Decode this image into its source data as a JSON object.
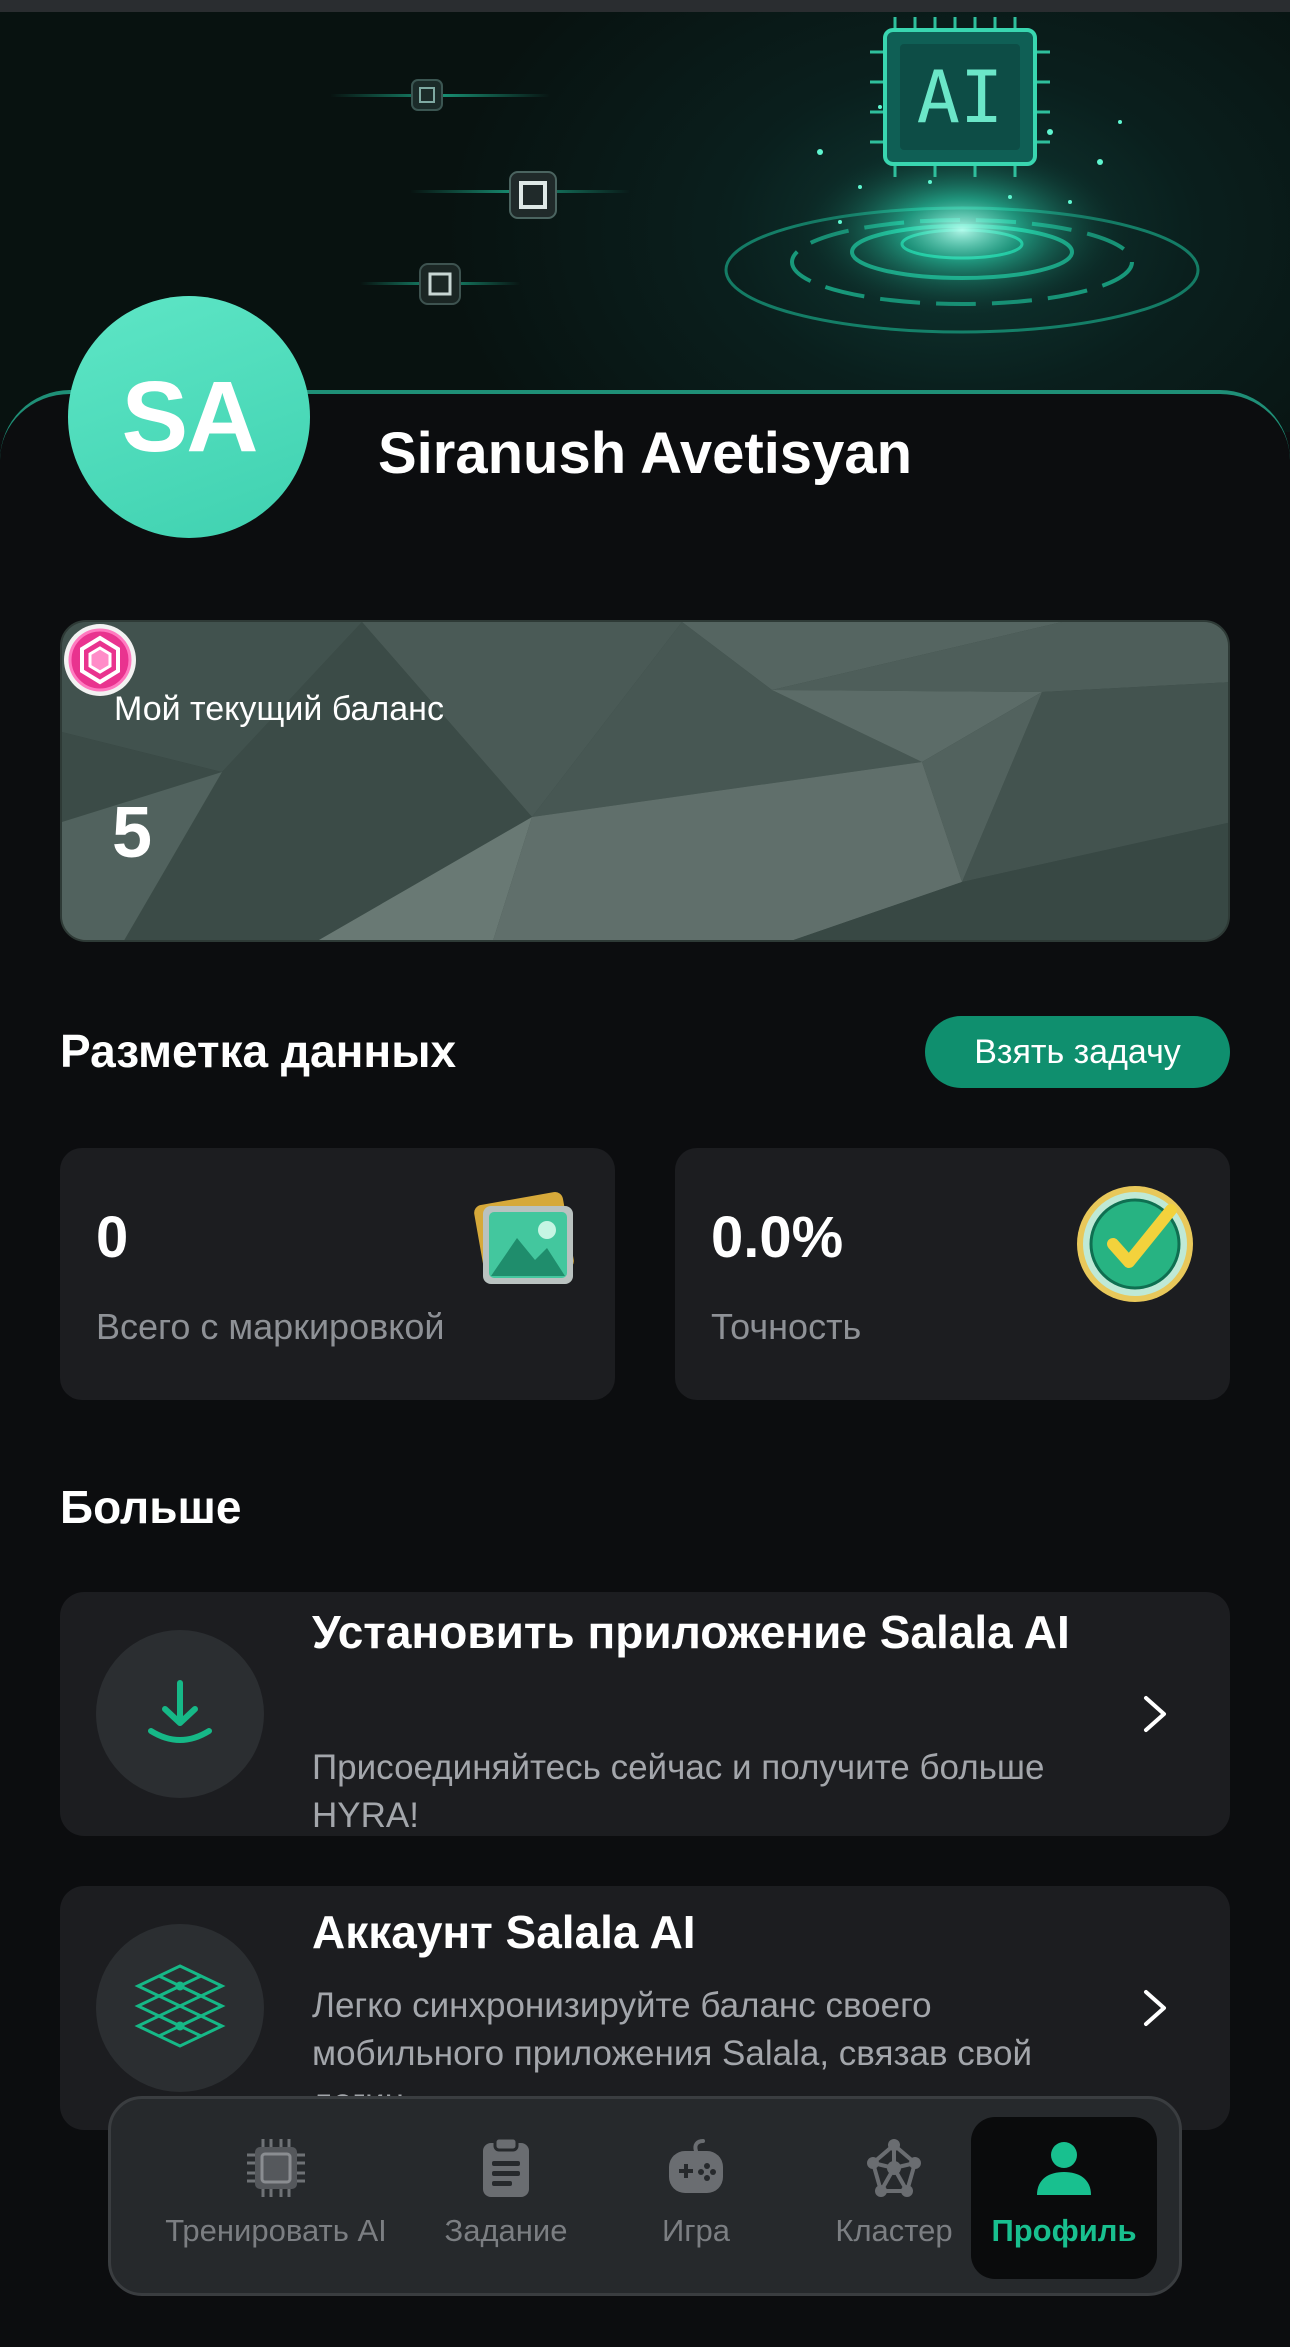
{
  "hero": {
    "chip_label": "AI"
  },
  "profile": {
    "initials": "SA",
    "name": "Siranush Avetisyan"
  },
  "balance": {
    "label": "Мой текущий баланс",
    "value": "5"
  },
  "labeling": {
    "title": "Разметка данных",
    "take_task_label": "Взять задачу",
    "stats": [
      {
        "value": "0",
        "label": "Всего с маркировкой"
      },
      {
        "value": "0.0%",
        "label": "Точность"
      }
    ]
  },
  "more": {
    "title": "Больше",
    "items": [
      {
        "title": "Установить приложение Salala AI",
        "description": "Присоединяйтесь сейчас и получите больше HYRA!"
      },
      {
        "title": "Аккаунт Salala AI",
        "description": "Легко синхронизируйте баланс своего мобильного приложения Salala, связав свой логин"
      }
    ]
  },
  "nav": {
    "items": [
      {
        "label": "Тренировать AI",
        "icon": "chip-icon"
      },
      {
        "label": "Задание",
        "icon": "clipboard-icon"
      },
      {
        "label": "Игра",
        "icon": "gamepad-icon"
      },
      {
        "label": "Кластер",
        "icon": "network-icon"
      },
      {
        "label": "Профиль",
        "icon": "user-icon"
      }
    ],
    "active_index": 4
  },
  "colors": {
    "accent": "#0f8f6e",
    "accent_bright": "#18c08f",
    "avatar": "#4fdcbc",
    "card": "#1c1d20",
    "background": "#0c0d0f"
  }
}
